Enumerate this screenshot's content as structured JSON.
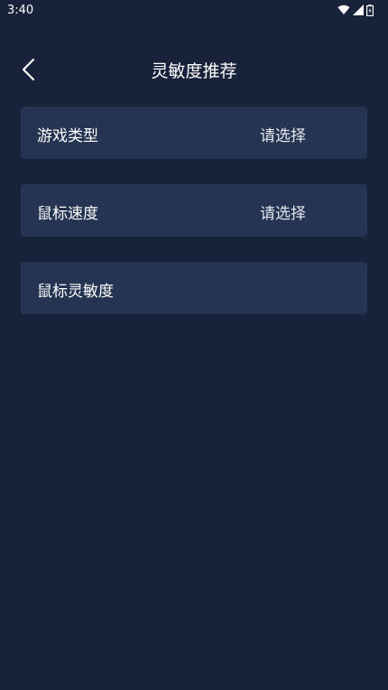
{
  "status_bar": {
    "time": "3:40",
    "icons": [
      "wifi-icon",
      "signal-icon",
      "battery-icon"
    ]
  },
  "header": {
    "back_icon": "chevron-left-icon",
    "title": "灵敏度推荐"
  },
  "rows": [
    {
      "label": "游戏类型",
      "value": "请选择"
    },
    {
      "label": "鼠标速度",
      "value": "请选择"
    },
    {
      "label": "鼠标灵敏度",
      "value": ""
    }
  ],
  "colors": {
    "background": "#18223b",
    "row_background": "#253452",
    "text": "#ffffff"
  }
}
